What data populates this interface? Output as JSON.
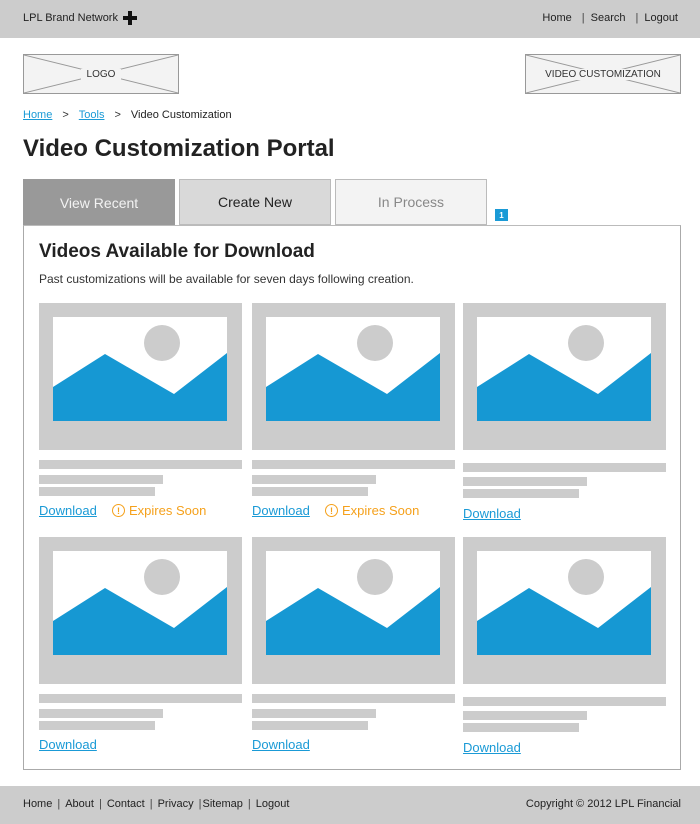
{
  "header": {
    "brand": "LPL Brand Network",
    "brand_icon": "plus-icon",
    "nav": [
      {
        "label": "Home"
      },
      {
        "label": "Search"
      },
      {
        "label": "Logout"
      }
    ],
    "separator": "|"
  },
  "placeholders": {
    "logo": "LOGO",
    "section_banner": "VIDEO CUSTOMIZATION"
  },
  "breadcrumb": {
    "items": [
      {
        "label": "Home",
        "link": true
      },
      {
        "label": "Tools",
        "link": true
      },
      {
        "label": "Video Customization",
        "link": false
      }
    ],
    "separator": ">"
  },
  "page_title": "Video Customization Portal",
  "tabs": [
    {
      "label": "View Recent",
      "state": "active"
    },
    {
      "label": "Create New",
      "state": "default"
    },
    {
      "label": "In Process",
      "state": "disabled"
    }
  ],
  "in_process_count": "1",
  "panel": {
    "title": "Videos Available for Download",
    "description": "Past customizations will be available for seven days following creation.",
    "cards": [
      {
        "download_label": "Download",
        "expires_label": "Expires Soon",
        "expires_icon": "alert-circle-icon"
      },
      {
        "download_label": "Download",
        "expires_label": "Expires Soon",
        "expires_icon": "alert-circle-icon"
      },
      {
        "download_label": "Download"
      },
      {
        "download_label": "Download"
      },
      {
        "download_label": "Download"
      },
      {
        "download_label": "Download"
      }
    ]
  },
  "footer": {
    "links": [
      {
        "label": "Home"
      },
      {
        "label": "About"
      },
      {
        "label": "Contact"
      },
      {
        "label": "Privacy"
      },
      {
        "label": "Sitemap"
      },
      {
        "label": "Logout"
      }
    ],
    "separator": "|",
    "copyright": "Copyright © 2012 LPL Financial"
  },
  "colors": {
    "accent": "#1a9ad6",
    "warning": "#f5a11c",
    "bar_gray": "#cccccc",
    "tab_active": "#999999"
  }
}
